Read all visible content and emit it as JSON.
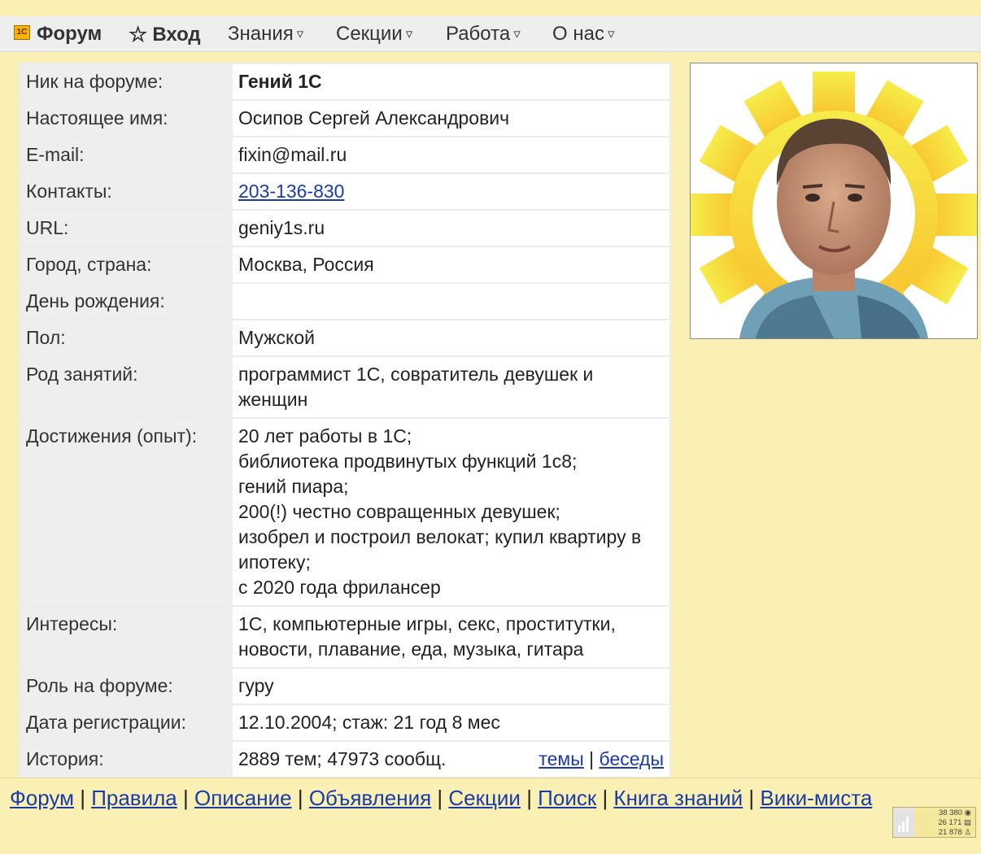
{
  "nav": {
    "logo_text": "1С",
    "forum": "Форум",
    "login": "Вход",
    "knowledge": "Знания",
    "sections": "Секции",
    "work": "Работа",
    "about": "О нас",
    "caret": "▿",
    "star": "☆"
  },
  "profile": {
    "rows": [
      {
        "label": "Ник на форуме:",
        "value": "Гений 1С"
      },
      {
        "label": "Настоящее имя:",
        "value": "Осипов Сергей Александрович"
      },
      {
        "label": "E-mail:",
        "value": "fixin@mail.ru"
      },
      {
        "label": "Контакты:",
        "value": "203-136-830"
      },
      {
        "label": "URL:",
        "value": "geniy1s.ru"
      },
      {
        "label": "Город, страна:",
        "value": "Москва, Россия"
      },
      {
        "label": "День рождения:",
        "value": ""
      },
      {
        "label": "Пол:",
        "value": "Мужской"
      },
      {
        "label": "Род занятий:",
        "value": "программист 1С, совратитель девушек и женщин"
      },
      {
        "label": "Достижения (опыт):",
        "value": "20 лет работы в 1С;\nбиблиотека продвинутых функций 1с8;\nгений пиара;\n200(!) честно совращенных девушек;\nизобрел и построил велокат; купил квартиру в ипотеку;\nс 2020 года фрилансер"
      },
      {
        "label": "Интересы:",
        "value": "1С, компьютерные игры, секс, проститутки, новости, плавание, еда, музыка, гитара"
      },
      {
        "label": "Роль на форуме:",
        "value": "гуру"
      },
      {
        "label": "Дата регистрации:",
        "value": "12.10.2004; стаж: 21 год 8 мес"
      },
      {
        "label": "История:",
        "value": "2889 тем; 47973 сообщ."
      }
    ],
    "history_topics_link": "темы",
    "history_separator": "|",
    "history_chats_link": "беседы"
  },
  "footer": {
    "links": [
      "Форум",
      "Правила",
      "Описание",
      "Объявления",
      "Секции",
      "Поиск",
      "Книга знаний",
      "Вики-миста"
    ],
    "separator": " | "
  },
  "counter": {
    "views": "38 380",
    "visits": "26 171",
    "visitors": "21 878"
  },
  "colors": {
    "page_bg": "#fbf0b3",
    "nav_bg": "#eeeeee",
    "link": "#1a3caa",
    "label_bg": "#eeeeee"
  }
}
